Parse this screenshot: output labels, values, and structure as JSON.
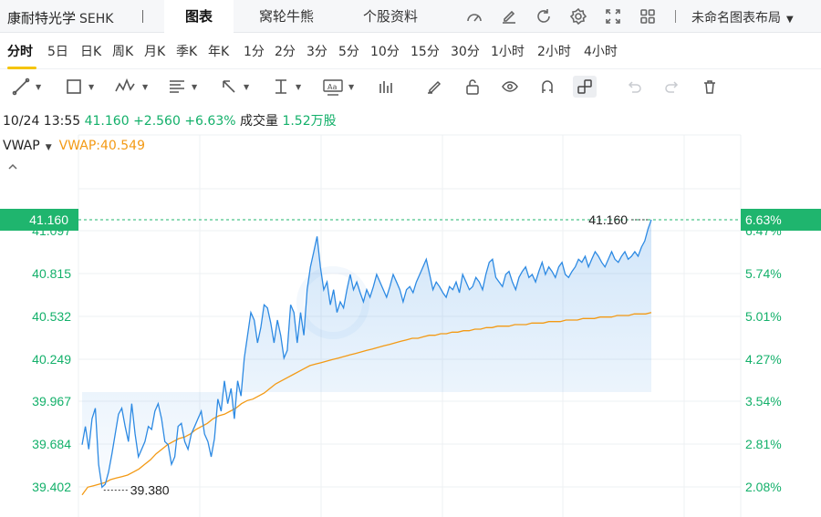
{
  "header": {
    "stock_name": "康耐特光学",
    "market": "SEHK",
    "tabs": [
      {
        "label": "图表",
        "active": true
      },
      {
        "label": "窝轮牛熊",
        "active": false
      },
      {
        "label": "个股资料",
        "active": false
      }
    ],
    "layout_label": "未命名图表布局"
  },
  "periods": [
    "分时",
    "5日",
    "日K",
    "周K",
    "月K",
    "季K",
    "年K",
    "1分",
    "2分",
    "3分",
    "5分",
    "10分",
    "15分",
    "30分",
    "1小时",
    "2小时",
    "4小时"
  ],
  "active_period": "分时",
  "quote": {
    "datetime": "10/24 13:55",
    "price": "41.160",
    "change": "+2.560",
    "change_pct": "+6.63%",
    "volume_label": "成交量",
    "volume": "1.52万股"
  },
  "indicator": {
    "name": "VWAP",
    "value_text": "VWAP:40.549"
  },
  "colors": {
    "up": "#13b06a",
    "price_line": "#2d8ae3",
    "vwap_line": "#f39a15",
    "current_tag": "#1fb56e"
  },
  "chart_data": {
    "type": "line",
    "y_labels_left": [
      "41.097",
      "40.815",
      "40.532",
      "40.249",
      "39.967",
      "39.684",
      "39.402"
    ],
    "y_labels_right": [
      "6.47%",
      "5.74%",
      "5.01%",
      "4.27%",
      "3.54%",
      "2.81%",
      "2.08%"
    ],
    "current_price_tag": "41.160",
    "current_pct_tag": "6.63%",
    "high_label": "41.160",
    "low_label": "39.380",
    "ylim": [
      39.35,
      41.2
    ],
    "x_count": 200,
    "series": [
      {
        "key": "price",
        "values": [
          39.68,
          39.8,
          39.65,
          39.85,
          39.92,
          39.55,
          39.4,
          39.42,
          39.5,
          39.62,
          39.75,
          39.88,
          39.92,
          39.8,
          39.7,
          39.95,
          39.75,
          39.6,
          39.65,
          39.7,
          39.8,
          39.78,
          39.9,
          39.95,
          39.85,
          39.7,
          39.68,
          39.55,
          39.6,
          39.8,
          39.82,
          39.7,
          39.65,
          39.75,
          39.8,
          39.85,
          39.9,
          39.75,
          39.7,
          39.6,
          39.72,
          39.98,
          39.9,
          40.1,
          39.95,
          40.05,
          39.85,
          40.1,
          40.0,
          40.25,
          40.4,
          40.55,
          40.5,
          40.35,
          40.45,
          40.6,
          40.58,
          40.48,
          40.35,
          40.5,
          40.4,
          40.25,
          40.3,
          40.6,
          40.55,
          40.35,
          40.55,
          40.4,
          40.7,
          40.85,
          40.95,
          41.05,
          40.85,
          40.7,
          40.75,
          40.6,
          40.7,
          40.55,
          40.62,
          40.58,
          40.7,
          40.8,
          40.7,
          40.75,
          40.68,
          40.62,
          40.7,
          40.65,
          40.72,
          40.8,
          40.75,
          40.7,
          40.65,
          40.72,
          40.8,
          40.75,
          40.7,
          40.62,
          40.7,
          40.72,
          40.68,
          40.75,
          40.8,
          40.85,
          40.9,
          40.8,
          40.7,
          40.75,
          40.72,
          40.68,
          40.65,
          40.72,
          40.7,
          40.75,
          40.68,
          40.8,
          40.75,
          40.7,
          40.72,
          40.78,
          40.75,
          40.7,
          40.8,
          40.88,
          40.9,
          40.78,
          40.75,
          40.72,
          40.8,
          40.82,
          40.75,
          40.7,
          40.78,
          40.82,
          40.85,
          40.78,
          40.8,
          40.75,
          40.82,
          40.88,
          40.8,
          40.85,
          40.82,
          40.78,
          40.85,
          40.88,
          40.8,
          40.78,
          40.82,
          40.85,
          40.9,
          40.88,
          40.92,
          40.85,
          40.9,
          40.95,
          40.92,
          40.88,
          40.85,
          40.9,
          40.95,
          40.9,
          40.88,
          40.92,
          40.95,
          40.9,
          40.92,
          40.95,
          40.92,
          40.98,
          41.02,
          41.1,
          41.16
        ]
      },
      {
        "key": "vwap",
        "values": [
          39.35,
          39.4,
          39.41,
          39.42,
          39.43,
          39.45,
          39.46,
          39.47,
          39.48,
          39.5,
          39.52,
          39.55,
          39.58,
          39.62,
          39.65,
          39.68,
          39.7,
          39.72,
          39.73,
          39.75,
          39.78,
          39.8,
          39.82,
          39.85,
          39.87,
          39.88,
          39.9,
          39.92,
          39.95,
          39.97,
          39.98,
          40.0,
          40.02,
          40.05,
          40.08,
          40.1,
          40.12,
          40.14,
          40.16,
          40.18,
          40.2,
          40.21,
          40.22,
          40.23,
          40.24,
          40.25,
          40.26,
          40.27,
          40.28,
          40.29,
          40.3,
          40.31,
          40.32,
          40.33,
          40.34,
          40.35,
          40.36,
          40.37,
          40.38,
          40.38,
          40.39,
          40.4,
          40.4,
          40.41,
          40.41,
          40.42,
          40.42,
          40.43,
          40.43,
          40.44,
          40.44,
          40.45,
          40.45,
          40.46,
          40.46,
          40.46,
          40.47,
          40.47,
          40.47,
          40.48,
          40.48,
          40.48,
          40.49,
          40.49,
          40.49,
          40.5,
          40.5,
          40.5,
          40.51,
          40.51,
          40.51,
          40.52,
          40.52,
          40.52,
          40.53,
          40.53,
          40.53,
          40.54,
          40.54,
          40.54,
          40.55
        ]
      }
    ]
  }
}
